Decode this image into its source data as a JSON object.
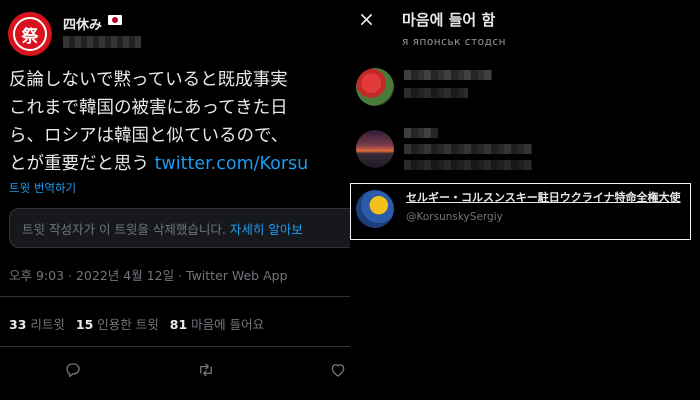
{
  "tweet": {
    "avatar_char": "祭",
    "display_name": "四休み",
    "text_lines": [
      "反論しないで黙っていると既成事実",
      "これまで韓国の被害にあってきた日",
      "ら、ロシアは韓国と似ているので、"
    ],
    "text_last_prefix": "とが重要だと思う ",
    "text_link": "twitter.com/Korsu",
    "translate_label": "트윗 번역하기",
    "deleted_notice": "트윗 작성자가 이 트윗을 삭제했습니다. ",
    "deleted_learn_more": "자세히 알아보",
    "meta": "오후 9:03 · 2022년 4월 12일 · Twitter Web App",
    "stats": {
      "retweets_count": "33",
      "retweets_label": "리트윗",
      "quotes_count": "15",
      "quotes_label": "인용한 트윗",
      "likes_count": "81",
      "likes_label": "마음에 들어요"
    },
    "icons": [
      "reply-icon",
      "retweet-icon",
      "like-icon"
    ],
    "colors": {
      "accent": "#1d9bf0",
      "avatar_bg": "#d8131e",
      "muted": "#71767b"
    }
  },
  "likes_modal": {
    "title": "마음에 들어 함",
    "close_icon": "close-icon",
    "prev_bio_fragment": "я японськ стодсн",
    "highlighted_user": {
      "name": "セルギー・コルスンスキー駐日ウクライナ特命全権大使",
      "handle": "@KorsunskySergiy"
    }
  }
}
